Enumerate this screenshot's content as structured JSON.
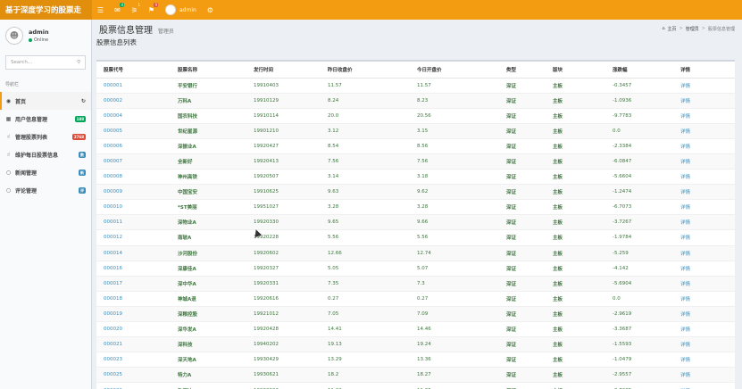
{
  "app": {
    "brand": "基于深度学习的股票走",
    "top_user": "admin",
    "badges": {
      "mail": "4",
      "bell": "1",
      "flag": "9"
    },
    "colors": {
      "topbar": "#f39c12",
      "accent": "#00a65a"
    }
  },
  "sidebar": {
    "user_name": "admin",
    "status": "Online",
    "search_placeholder": "Search...",
    "nav_header": "导航栏",
    "items": [
      {
        "icon": "dashboard-icon",
        "label": "首页",
        "pill": ""
      },
      {
        "icon": "users-icon",
        "label": "用户信息管理",
        "pill": "188"
      },
      {
        "icon": "thumbs-up-icon",
        "label": "管理股票列表",
        "pill": "2768"
      },
      {
        "icon": "thumbs-up-icon",
        "label": "维护每日股票信息",
        "pill": "数"
      },
      {
        "icon": "comment-icon",
        "label": "新闻管理",
        "pill": "新"
      },
      {
        "icon": "comment-icon",
        "label": "评论管理",
        "pill": "评"
      }
    ]
  },
  "header": {
    "title": "股票信息管理",
    "subtitle": "管理员",
    "crumb": [
      "主页",
      "管理员",
      "股票信息管理"
    ]
  },
  "box_title": "股票信息列表",
  "table": {
    "columns": [
      "股票代号",
      "股票名称",
      "发行时间",
      "昨日收盘价",
      "今日开盘价",
      "类型",
      "版块",
      "涨跌幅",
      "详情"
    ],
    "rows": [
      [
        "000001",
        "平安银行",
        "19910403",
        "11.57",
        "11.57",
        "深证",
        "主板",
        "-0.3457",
        "详情"
      ],
      [
        "000002",
        "万科A",
        "19910129",
        "8.24",
        "8.23",
        "深证",
        "主板",
        "-1.0936",
        "详情"
      ],
      [
        "000004",
        "国农科技",
        "19910114",
        "20.0",
        "20.56",
        "深证",
        "主板",
        "-9.7783",
        "详情"
      ],
      [
        "000005",
        "世纪星源",
        "19901210",
        "3.12",
        "3.15",
        "深证",
        "主板",
        "0.0",
        "详情"
      ],
      [
        "000006",
        "深振业A",
        "19920427",
        "8.54",
        "8.56",
        "深证",
        "主板",
        "-2.3384",
        "详情"
      ],
      [
        "000007",
        "全新好",
        "19920413",
        "7.56",
        "7.56",
        "深证",
        "主板",
        "-6.0847",
        "详情"
      ],
      [
        "000008",
        "神州高铁",
        "19920507",
        "3.14",
        "3.18",
        "深证",
        "主板",
        "-5.6604",
        "详情"
      ],
      [
        "000009",
        "中国宝安",
        "19910625",
        "9.63",
        "9.62",
        "深证",
        "主板",
        "-1.2474",
        "详情"
      ],
      [
        "000010",
        "*ST美丽",
        "19951027",
        "3.28",
        "3.28",
        "深证",
        "主板",
        "-6.7073",
        "详情"
      ],
      [
        "000011",
        "深物业A",
        "19920330",
        "9.65",
        "9.66",
        "深证",
        "主板",
        "-3.7267",
        "详情"
      ],
      [
        "000012",
        "南玻A",
        "19920228",
        "5.56",
        "5.56",
        "深证",
        "主板",
        "-1.9784",
        "详情"
      ],
      [
        "000014",
        "沙河股份",
        "19920602",
        "12.66",
        "12.74",
        "深证",
        "主板",
        "-5.259",
        "详情"
      ],
      [
        "000016",
        "深康佳A",
        "19920327",
        "5.05",
        "5.07",
        "深证",
        "主板",
        "-4.142",
        "详情"
      ],
      [
        "000017",
        "深中华A",
        "19920331",
        "7.35",
        "7.3",
        "深证",
        "主板",
        "-5.6904",
        "详情"
      ],
      [
        "000018",
        "神城A退",
        "19920616",
        "0.27",
        "0.27",
        "深证",
        "主板",
        "0.0",
        "详情"
      ],
      [
        "000019",
        "深粮控股",
        "19921012",
        "7.05",
        "7.09",
        "深证",
        "主板",
        "-2.9619",
        "详情"
      ],
      [
        "000020",
        "深华发A",
        "19920428",
        "14.41",
        "14.46",
        "深证",
        "主板",
        "-3.3687",
        "详情"
      ],
      [
        "000021",
        "深科技",
        "19940202",
        "19.13",
        "19.24",
        "深证",
        "主板",
        "-1.5593",
        "详情"
      ],
      [
        "000023",
        "深天地A",
        "19930429",
        "13.29",
        "13.36",
        "深证",
        "主板",
        "-1.0479",
        "详情"
      ],
      [
        "000025",
        "特力A",
        "19930621",
        "18.2",
        "18.27",
        "深证",
        "主板",
        "-2.9557",
        "详情"
      ],
      [
        "000026",
        "飞亚达A",
        "19930603",
        "11.32",
        "11.35",
        "深证",
        "主板",
        "-3.7685",
        "详情"
      ]
    ]
  }
}
